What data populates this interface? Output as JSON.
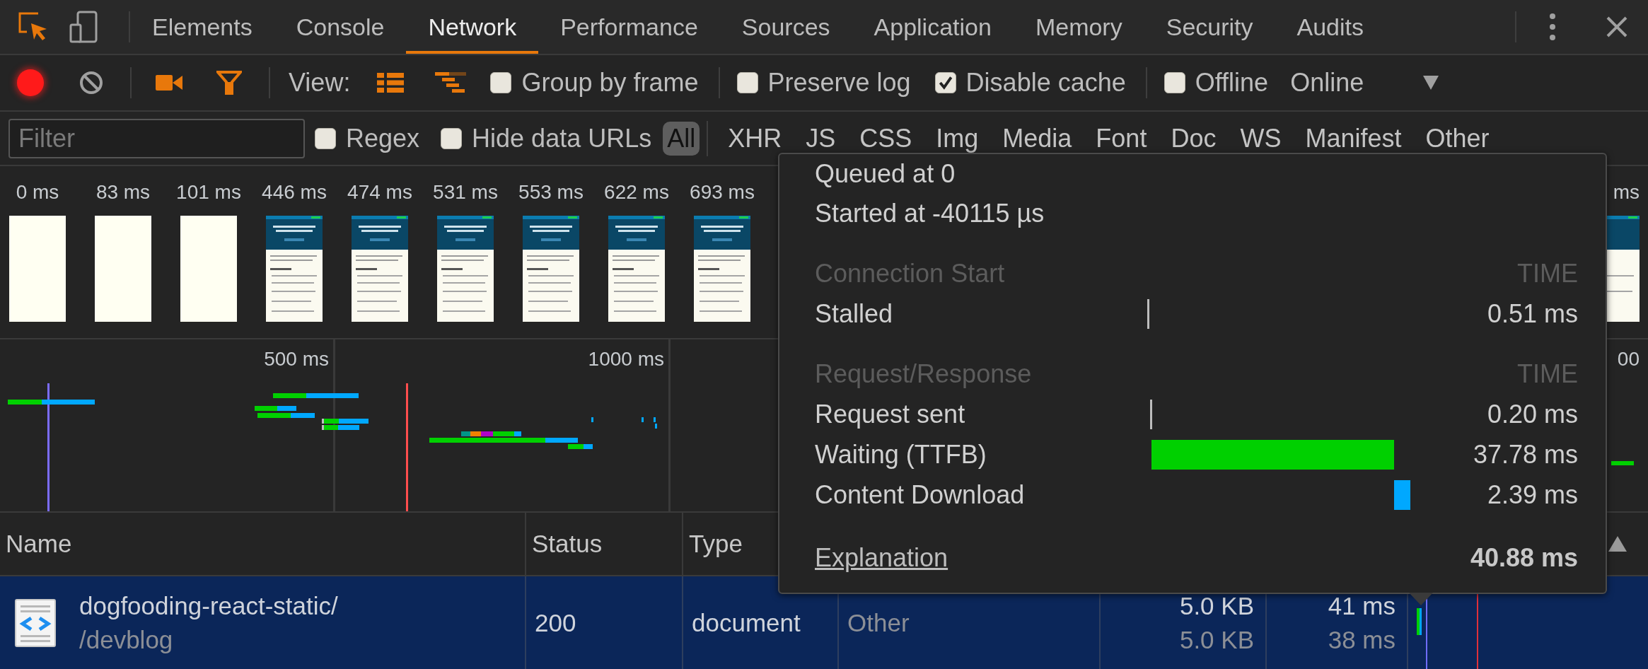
{
  "tabs": [
    {
      "label": "Elements",
      "selected": false
    },
    {
      "label": "Console",
      "selected": false
    },
    {
      "label": "Network",
      "selected": true
    },
    {
      "label": "Performance",
      "selected": false
    },
    {
      "label": "Sources",
      "selected": false
    },
    {
      "label": "Application",
      "selected": false
    },
    {
      "label": "Memory",
      "selected": false
    },
    {
      "label": "Security",
      "selected": false
    },
    {
      "label": "Audits",
      "selected": false
    }
  ],
  "recording": true,
  "screenshots": true,
  "filter_bar": true,
  "view": {
    "label": "View:",
    "large_rows": true,
    "overview": true
  },
  "option_groups": [
    [
      {
        "label": "Group by frame",
        "checked": false
      }
    ],
    [
      {
        "label": "Preserve log",
        "checked": false
      },
      {
        "label": "Disable cache",
        "checked": true
      }
    ],
    [
      {
        "label": "Offline",
        "checked": false
      }
    ]
  ],
  "throttling": {
    "value": "Online"
  },
  "filter": {
    "placeholder": "Filter"
  },
  "filter_options": [
    {
      "label": "Regex",
      "checked": false
    },
    {
      "label": "Hide data URLs",
      "checked": false
    }
  ],
  "type_filters": [
    {
      "label": "All",
      "selected": true
    },
    {
      "label": "XHR",
      "selected": false
    },
    {
      "label": "JS",
      "selected": false
    },
    {
      "label": "CSS",
      "selected": false
    },
    {
      "label": "Img",
      "selected": false
    },
    {
      "label": "Media",
      "selected": false
    },
    {
      "label": "Font",
      "selected": false
    },
    {
      "label": "Doc",
      "selected": false
    },
    {
      "label": "WS",
      "selected": false
    },
    {
      "label": "Manifest",
      "selected": false
    },
    {
      "label": "Other",
      "selected": false
    }
  ],
  "filmstrip": {
    "frames": [
      {
        "label": "0 ms",
        "kind": "blank"
      },
      {
        "label": "83 ms",
        "kind": "blank"
      },
      {
        "label": "101 ms",
        "kind": "blank"
      },
      {
        "label": "446 ms",
        "kind": "page"
      },
      {
        "label": "474 ms",
        "kind": "page"
      },
      {
        "label": "531 ms",
        "kind": "page"
      },
      {
        "label": "553 ms",
        "kind": "page"
      },
      {
        "label": "622 ms",
        "kind": "page"
      },
      {
        "label": "693 ms",
        "kind": "page"
      }
    ],
    "partial_frame": {
      "label": "ms",
      "kind": "page"
    }
  },
  "overview": {
    "ticks": [
      "500 ms",
      "1000 ms"
    ],
    "partial_tick": "00"
  },
  "table": {
    "columns": [
      "Name",
      "Status",
      "Type"
    ],
    "rows": [
      {
        "selected": true,
        "name": "dogfooding-react-static/",
        "path": "/devblog",
        "status": "200",
        "type": "document",
        "initiator": "Other",
        "size": "5.0 KB",
        "resource_size": "5.0 KB",
        "time": "41 ms",
        "latency": "38 ms"
      }
    ]
  },
  "timing": {
    "queued": "Queued at 0",
    "started": "Started at -40115 µs",
    "sections": [
      {
        "title": "Connection Start",
        "time_header": "TIME",
        "phases": [
          {
            "label": "Stalled",
            "color": "#bdbdbd",
            "value": "0.51 ms"
          }
        ]
      },
      {
        "title": "Request/Response",
        "time_header": "TIME",
        "phases": [
          {
            "label": "Request sent",
            "color": "#bdbdbd",
            "value": "0.20 ms"
          },
          {
            "label": "Waiting (TTFB)",
            "color": "#00d000",
            "value": "37.78 ms"
          },
          {
            "label": "Content Download",
            "color": "#00a8ff",
            "value": "2.39 ms"
          }
        ]
      }
    ],
    "link": "Explanation",
    "total": "40.88 ms"
  }
}
